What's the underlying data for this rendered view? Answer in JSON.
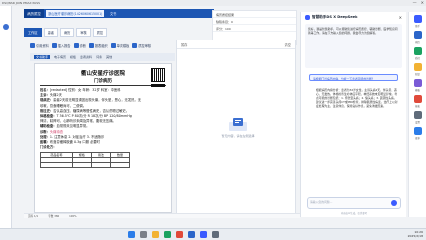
{
  "window": {
    "title": "DSQNSR JOIN PMAX PASS",
    "minimize": "—",
    "close": "✕"
  },
  "app": {
    "logo": "病历质控",
    "doc_tab": "浙山医疗谱诊病历(1426060615001)",
    "header_text": "文书"
  },
  "nav": [
    "工作区",
    "患者",
    "病历",
    "审核",
    "质控"
  ],
  "toolbar": [
    "引用资料",
    "插入报告",
    "诊断",
    "报表组织",
    "单次模板",
    "质控审核"
  ],
  "subbar": [
    "文书助手",
    "电子病历",
    "模板",
    "患者资料",
    "词条",
    "其他"
  ],
  "document": {
    "hospital": "衢山安星疗诊医院",
    "title": "门诊病历",
    "lines": [
      {
        "k": "姓名：",
        "v": "[redacted] 性别：女  年龄：32岁  科室：中医科"
      },
      {
        "k": "主诉：",
        "v": "头痛2天"
      },
      {
        "k": "现病史：",
        "v": "患者2天前无明显诱因出现头痛，伴头晕，恶心，无发热，无"
      },
      {
        "k": "",
        "v": "咳嗽，饮食睡眠尚可，二便调。"
      },
      {
        "k": "既往史：",
        "v": "否认高血压、糖尿病等慢性病史，否认药物过敏史。"
      },
      {
        "k": "体格检查：",
        "v": "T 36.5℃  P 80次/分  R 18次/分  BP 120/80mmHg"
      },
      {
        "k": "",
        "v": "神清，精神可，心肺听诊未闻及异常，腹软无压痛。"
      },
      {
        "k": "辅助检查：",
        "v": "血常规未见明显异常。"
      },
      {
        "k": "诊断：",
        "v": "头痛待查",
        "pink": true
      },
      {
        "k": "处理：",
        "v": "1. 注意休息  2. 对症治疗  3. 不适随诊"
      },
      {
        "k": "医嘱：",
        "v": "布洛芬缓释胶囊 0.3g 口服 必要时"
      }
    ],
    "table_caption": "门诊处方：",
    "table_headers": [
      "药品名称",
      "规格",
      "用法",
      "数量"
    ]
  },
  "mid": {
    "left": "暂存",
    "right": "清空",
    "empty_text": "暂无内容，请在左侧选择"
  },
  "right_block": [
    "病历质控结果",
    "缺陷条目：0",
    "评分：100"
  ],
  "deepseek": {
    "title": "智慧助手DS X DeepSeek",
    "intro": "您好，我是智慧助手，可以帮助您进行病历质控、辅助诊断、医学知识问答等工作。请在下方输入您的问题，我会尽力为您解答。",
    "suggestion": "请根据门诊病历内容，分析一下患者可能的诊断？",
    "answer": "根据病历内容分析：患者为32岁女性，主诉头痛2天，伴头晕、恶心，无发热。体格检查生命体征平稳，神经系统未见明显异常。考虑可能的诊断包括：1. 紧张型头痛；2. 偏头痛；3. 颈源性头痛。建议进一步完善头颅CT或MRI检查，排除器质性病变。治疗上以对症处理为主，注意休息，保持良好作息，避免诱发因素。",
    "input_placeholder": "请输入您的问题…",
    "footer": "内容由AI生成，仅供参考"
  },
  "dock": [
    "助手",
    "病历",
    "质控",
    "知识",
    "模板",
    "报表",
    "设置",
    "更多"
  ],
  "status": [
    "页码 1/1",
    "字数 386",
    "100%"
  ],
  "clock": {
    "time": "10:26",
    "date": "2025/2/18"
  },
  "colors": {
    "primary": "#1d56b3",
    "deepseek_accent": "#3a5bff",
    "diagnosis": "#d1436b"
  }
}
